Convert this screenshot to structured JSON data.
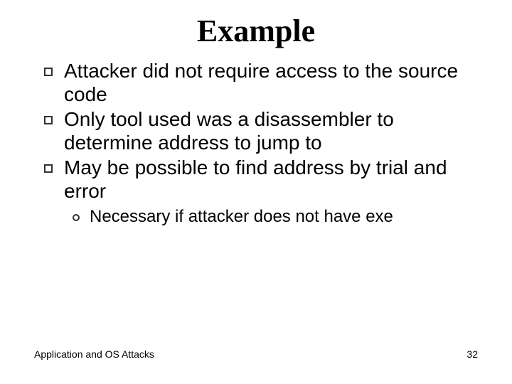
{
  "title": "Example",
  "bullets": [
    {
      "text": "Attacker did not require access to the source code"
    },
    {
      "text": "Only tool used was a disassembler to determine address to jump to"
    },
    {
      "text": "May be possible to find address by trial and error"
    }
  ],
  "subbullets": [
    {
      "text": "Necessary if attacker does not have exe"
    }
  ],
  "footer": {
    "left": "Application and OS Attacks",
    "page": "32"
  }
}
